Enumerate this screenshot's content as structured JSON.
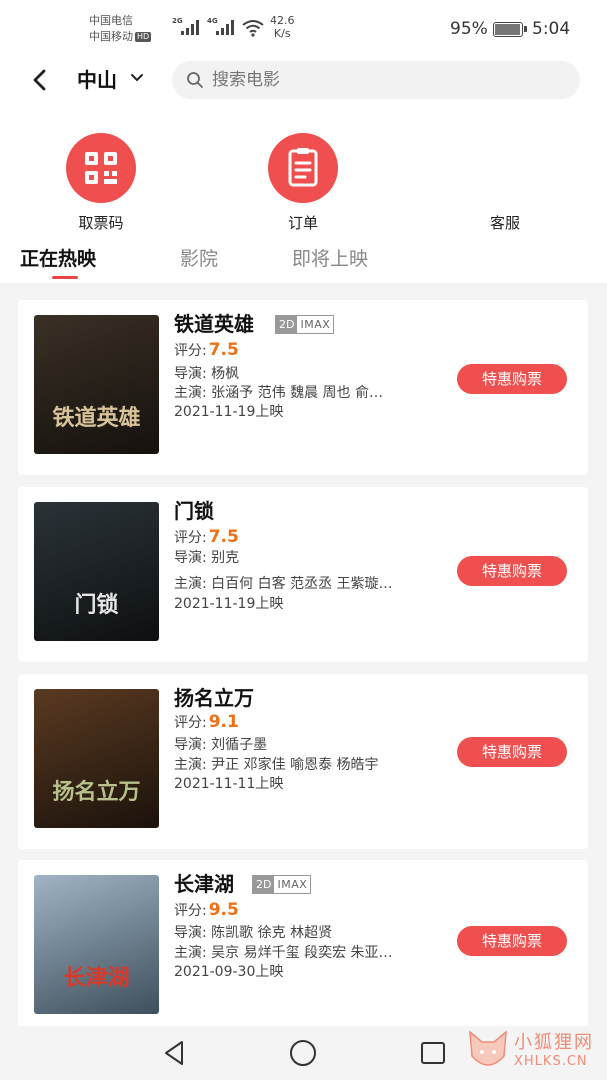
{
  "status_bar": {
    "carrier1": "中国电信",
    "carrier2": "中国移动",
    "hd": "HD",
    "net1": "2G",
    "net2": "4G",
    "speed_value": "42.6",
    "speed_unit": "K/s",
    "battery_pct": "95%",
    "battery_level": 0.95,
    "time": "5:04"
  },
  "header": {
    "city": "中山",
    "search_placeholder": "搜索电影"
  },
  "quick_actions": [
    {
      "label": "取票码",
      "icon": "qr-code-icon"
    },
    {
      "label": "订单",
      "icon": "order-list-icon"
    },
    {
      "label": "客服",
      "icon": "customer-service-icon"
    }
  ],
  "tabs": [
    {
      "label": "正在热映",
      "active": true
    },
    {
      "label": "影院",
      "active": false
    },
    {
      "label": "即将上映",
      "active": false
    }
  ],
  "movies": [
    {
      "title": "铁道英雄",
      "format_2d": "2D",
      "format_imax": "IMAX",
      "score_label": "评分:",
      "score": "7.5",
      "director": "导演:  杨枫",
      "cast": "主演:  张涵予  范伟  魏晨  周也  俞…",
      "release": "2021-11-19上映",
      "button": "特惠购票",
      "poster_text": "铁道英雄",
      "poster_colors": [
        "#3a3026",
        "#15110d"
      ]
    },
    {
      "title": "门锁",
      "score_label": "评分:",
      "score": "7.5",
      "director": "导演:  别克",
      "cast": "主演:  白百何  白客  范丞丞  王紫璇…",
      "release": "2021-11-19上映",
      "button": "特惠购票",
      "poster_text": "门锁",
      "poster_colors": [
        "#2b3338",
        "#0d1012"
      ]
    },
    {
      "title": "扬名立万",
      "score_label": "评分:",
      "score": "9.1",
      "director": "导演:  刘循子墨",
      "cast": "主演:  尹正  邓家佳  喻恩泰  杨皓宇",
      "release": "2021-11-11上映",
      "button": "特惠购票",
      "poster_text": "扬名立万",
      "poster_colors": [
        "#5a3a22",
        "#1b120b"
      ]
    },
    {
      "title": "长津湖",
      "format_2d": "2D",
      "format_imax": "IMAX",
      "score_label": "评分:",
      "score": "9.5",
      "director": "导演:  陈凯歌  徐克  林超贤",
      "cast": "主演:  吴京  易烊千玺  段奕宏  朱亚…",
      "release": "2021-09-30上映",
      "button": "特惠购票",
      "poster_text": "长津湖",
      "poster_colors": [
        "#9fb4c4",
        "#3f4f5c"
      ]
    }
  ],
  "watermark": {
    "name": "小狐狸网",
    "domain": "XHLKS.CN"
  },
  "colors": {
    "accent": "#ef4f4f",
    "score": "#f07016"
  }
}
